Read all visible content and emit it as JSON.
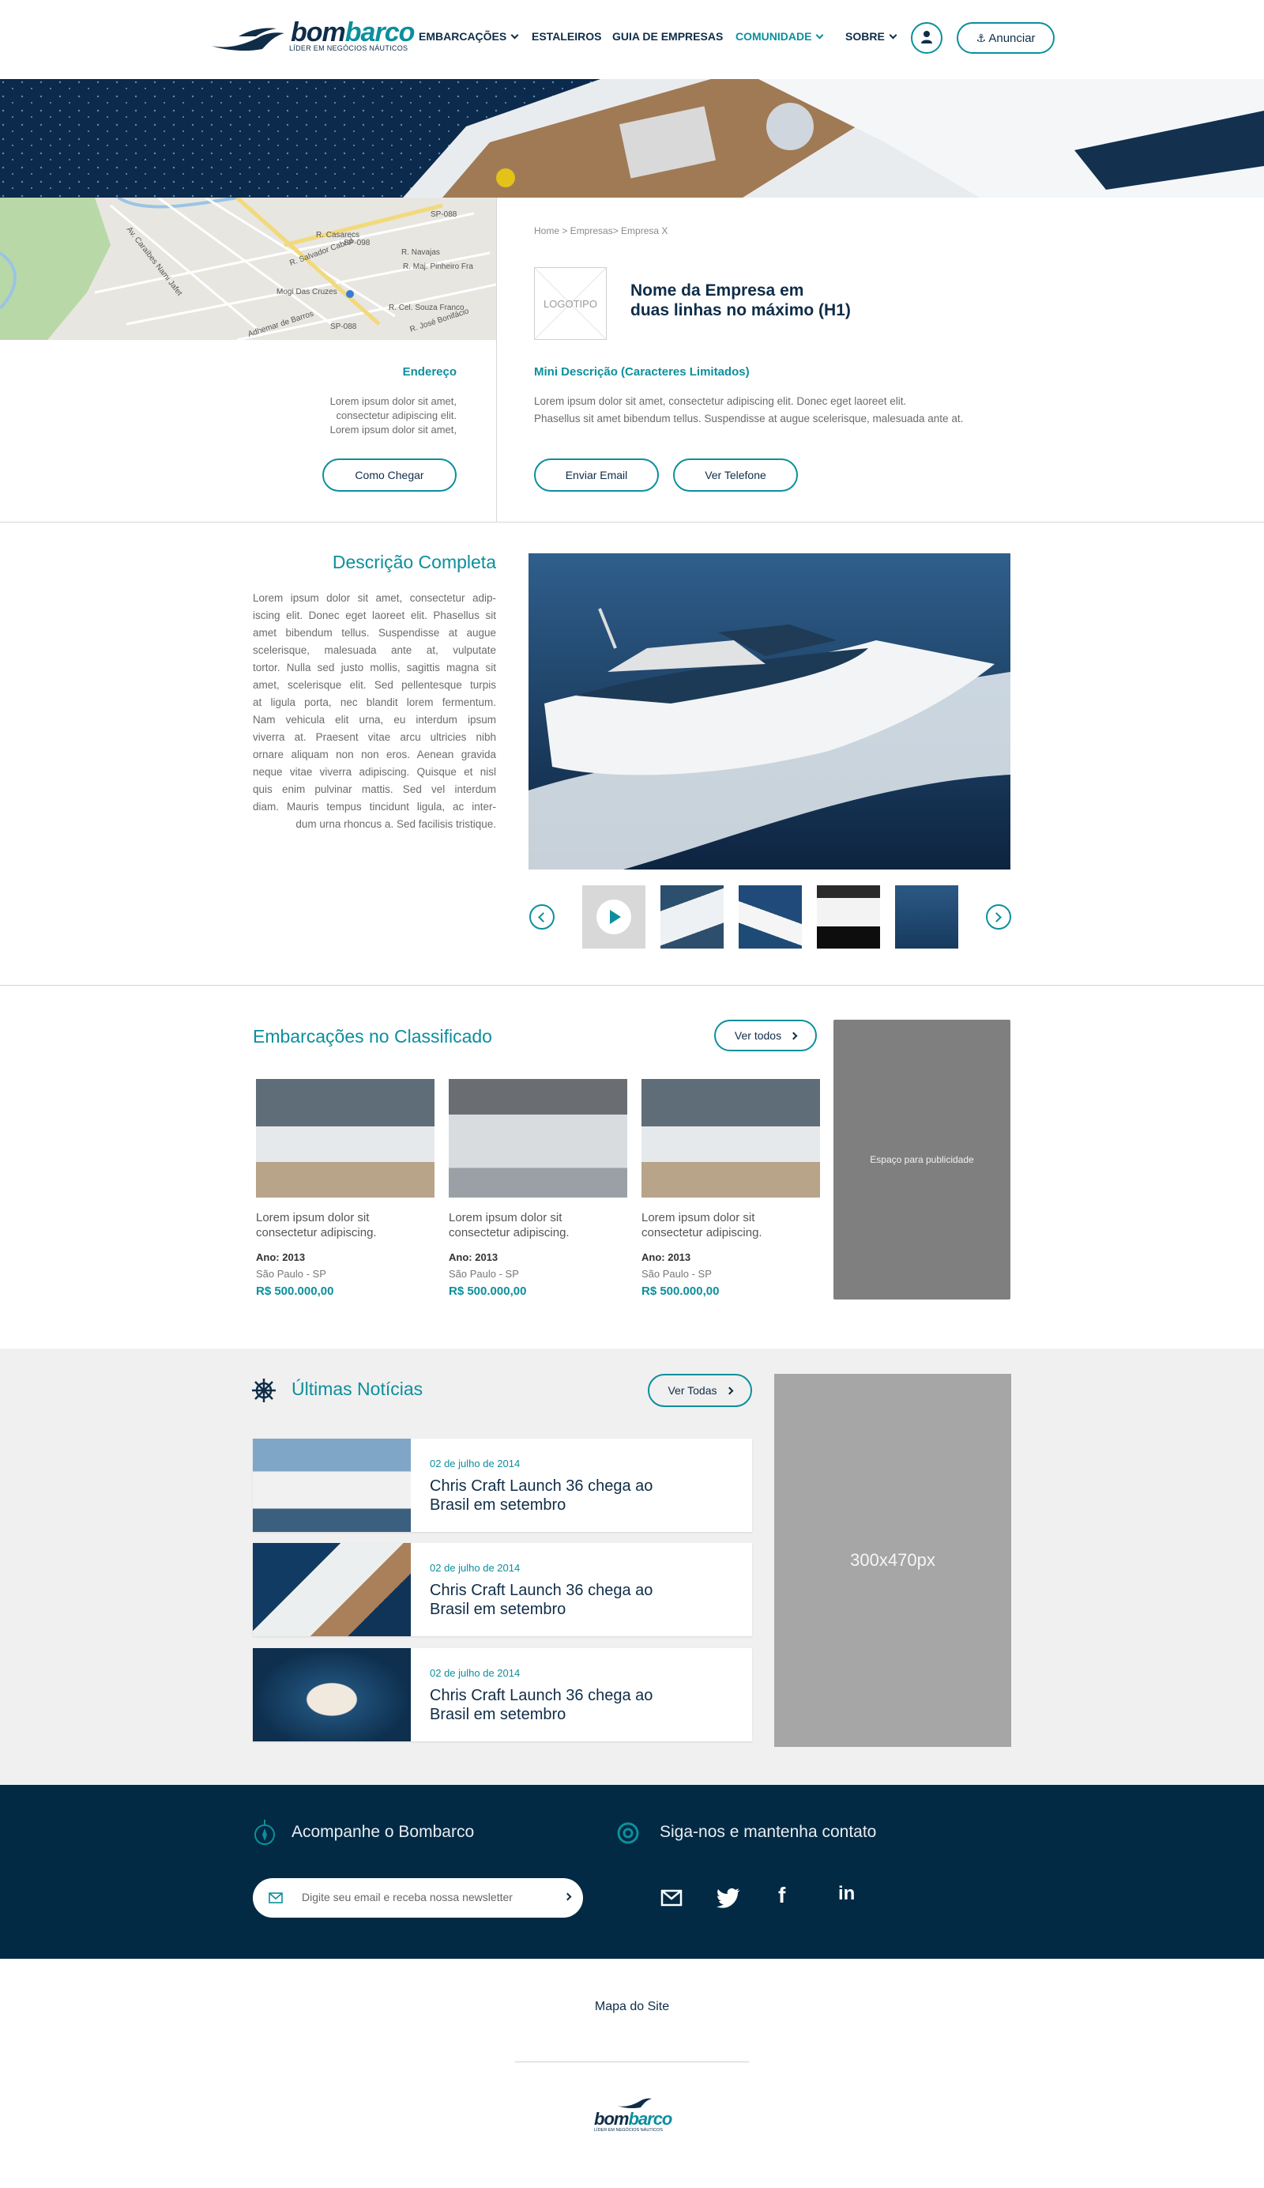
{
  "header": {
    "logo_text_a": "bom",
    "logo_text_b": "barco",
    "logo_tagline": "LÍDER EM NEGÓCIOS NÁUTICOS",
    "nav": [
      "EMBARCAÇÕES",
      "ESTALEIROS",
      "GUIA DE EMPRESAS",
      "COMUNIDADE",
      "SOBRE"
    ],
    "anunciar": "Anunciar"
  },
  "map": {
    "labels": [
      "Av. Caraíbes Nami Jafet",
      "SP-088",
      "R. Casarecs",
      "R. Salvador Cabral",
      "SP-098",
      "R. Navajas",
      "R. Maj. Pinheiro Fra",
      "Mogi Das Cruzes",
      "R. Cel. Souza Franco",
      "R. José Bonifácio",
      "Adhemar de Barros",
      "SP-088"
    ]
  },
  "company": {
    "breadcrumb": "Home > Empresas> Empresa X",
    "logo_placeholder": "LOGOTIPO",
    "name_line1": "Nome da Empresa em",
    "name_line2": "duas linhas no máximo (H1)",
    "mini_title": "Mini Descrição (Caracteres Limitados)",
    "mini_line1": "Lorem ipsum dolor sit amet, consectetur adipiscing elit. Donec eget laoreet elit.",
    "mini_line2": "Phasellus sit amet bibendum tellus. Suspendisse at augue scelerisque, malesuada ante at.",
    "btn_email": "Enviar Email",
    "btn_phone": "Ver Telefone"
  },
  "address": {
    "title": "Endereço",
    "line1": "Lorem ipsum dolor sit amet,",
    "line2": "consectetur adipiscing elit.",
    "line3": "Lorem ipsum dolor sit amet,",
    "btn": "Como Chegar"
  },
  "description": {
    "title": "Descrição Completa",
    "lines": [
      "Lorem ipsum dolor sit amet, consectetur adip-",
      "iscing elit. Donec eget laoreet elit. Phasellus sit",
      "amet bibendum tellus. Suspendisse at augue",
      "scelerisque, malesuada ante at, vulputate",
      "tortor. Nulla sed justo mollis, sagittis magna sit",
      "amet, scelerisque elit. Sed pellentesque turpis",
      "at ligula porta, nec blandit lorem fermentum.",
      "Nam vehicula elit urna, eu interdum ipsum",
      "viverra at. Praesent vitae arcu ultricies nibh",
      "ornare aliquam non non eros. Aenean gravida",
      "neque vitae viverra adipiscing. Quisque et nisl",
      "quis enim pulvinar mattis. Sed vel interdum",
      "diam. Mauris tempus tincidunt ligula, ac inter-",
      "dum urna rhoncus a. Sed facilisis tristique."
    ]
  },
  "classified": {
    "title": "Embarcações no Classificado",
    "ver_todos": "Ver todos",
    "ad": "Espaço para publicidade",
    "items": [
      {
        "desc1": "Lorem ipsum dolor sit",
        "desc2": "consectetur adipiscing.",
        "ano": "Ano: 2013",
        "city": "São Paulo - SP",
        "price": "R$ 500.000,00"
      },
      {
        "desc1": "Lorem ipsum dolor sit",
        "desc2": "consectetur adipiscing.",
        "ano": "Ano: 2013",
        "city": "São Paulo - SP",
        "price": "R$ 500.000,00"
      },
      {
        "desc1": "Lorem ipsum dolor sit",
        "desc2": "consectetur adipiscing.",
        "ano": "Ano: 2013",
        "city": "São Paulo - SP",
        "price": "R$ 500.000,00"
      }
    ]
  },
  "news": {
    "title": "Últimas Notícias",
    "ver_todas": "Ver Todas",
    "ad": "300x470px",
    "items": [
      {
        "date": "02 de julho de 2014",
        "title": "Chris Craft Launch 36 chega ao Brasil em setembro"
      },
      {
        "date": "02 de julho de 2014",
        "title": "Chris Craft Launch 36 chega ao Brasil em setembro"
      },
      {
        "date": "02 de julho de 2014",
        "title": "Chris Craft Launch 36 chega ao Brasil em setembro"
      }
    ]
  },
  "footer": {
    "follow": "Acompanhe o Bombarco",
    "contact": "Siga-nos e mantenha contato",
    "newsletter_placeholder": "Digite seu email e receba nossa newsletter",
    "sitemap": "Mapa do Site"
  },
  "colors": {
    "accent": "#0c8f9d",
    "navy": "#022a44",
    "ad_dark": "#7f7f7f",
    "ad_light": "#a6a6a6"
  }
}
